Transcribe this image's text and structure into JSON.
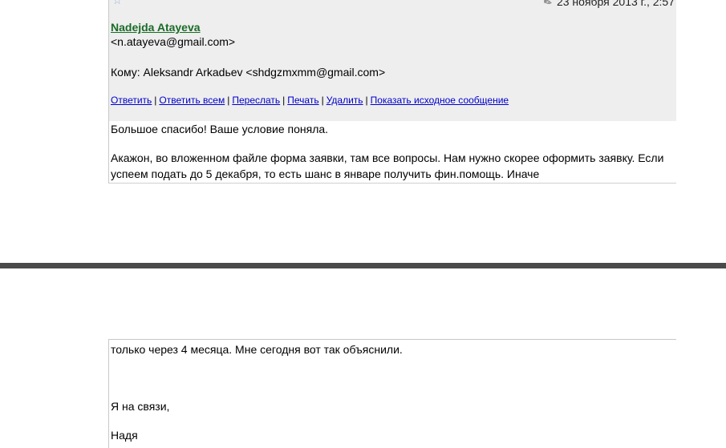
{
  "email": {
    "date": "23 ноября 2013 г., 2:57",
    "sender_name": "Nadejda Atayeva",
    "sender_email": "<n.atayeva@gmail.com>",
    "to_line": "Кому: Aleksandr Arkadьev <shdgzmxmm@gmail.com>",
    "actions": [
      "Ответить",
      "Ответить всем",
      "Переслать",
      "Печать",
      "Удалить",
      "Показать исходное сообщение"
    ],
    "separator": "|",
    "body_top": {
      "line1": "Большое спасибо! Ваше условие поняла.",
      "para2": "Акажон, во вложенном файле форма заявки, там все вопросы. Нам нужно скорее оформить заявку. Если успеем подать до 5 декабря, то есть шанс в январе получить фин.помощь. Иначе"
    },
    "body_bottom": {
      "line1": "только через 4 месяца. Мне сегодня вот так объяснили.",
      "line2": "Я на связи,",
      "line3": "Надя"
    }
  },
  "colors": {
    "header_bg": "#eeeeee",
    "sender_green": "#1a6b28",
    "link_blue": "#0000cc",
    "divider": "#4a4a4a"
  },
  "icons": {
    "star": "star-icon",
    "pencil": "pencil-icon"
  }
}
